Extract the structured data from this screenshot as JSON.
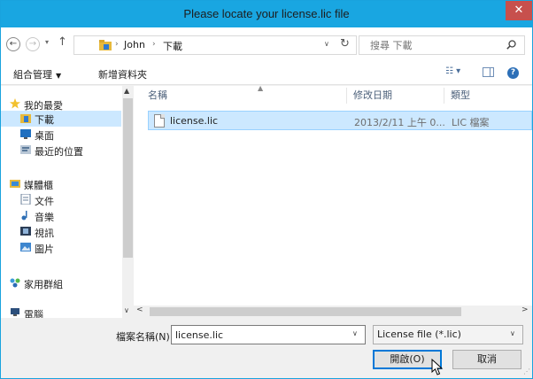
{
  "window": {
    "title": "Please locate your license.lic file",
    "close_glyph": "✕"
  },
  "address": {
    "back_glyph": "←",
    "forward_glyph": "→",
    "recent_glyph": "▾",
    "up_glyph": "↑",
    "crumbs": [
      "John",
      "下載"
    ],
    "crumb_sep": "›",
    "dropdown_glyph": "∨",
    "refresh_glyph": "↻"
  },
  "search": {
    "placeholder": "搜尋 下載"
  },
  "toolbar": {
    "organize_label": "組合管理",
    "organize_arrow": "▼",
    "new_folder_label": "新增資料夾",
    "view_glyph": "☷ ▾",
    "help_glyph": "?"
  },
  "nav": {
    "items": [
      {
        "label": "我的最愛",
        "icon": "star-icon"
      },
      {
        "label": "下載",
        "icon": "downloads-folder-icon"
      },
      {
        "label": "桌面",
        "icon": "desktop-icon"
      },
      {
        "label": "最近的位置",
        "icon": "recent-places-icon"
      },
      {
        "label": "媒體櫃",
        "icon": "libraries-icon"
      },
      {
        "label": "文件",
        "icon": "documents-icon"
      },
      {
        "label": "音樂",
        "icon": "music-icon"
      },
      {
        "label": "視訊",
        "icon": "videos-icon"
      },
      {
        "label": "圖片",
        "icon": "pictures-icon"
      },
      {
        "label": "家用群組",
        "icon": "homegroup-icon"
      },
      {
        "label": "電腦",
        "icon": "computer-icon"
      }
    ],
    "scroll_up": "▲",
    "scroll_down": "∨"
  },
  "files": {
    "columns": {
      "name": "名稱",
      "date": "修改日期",
      "type": "類型"
    },
    "sort_glyph": "▲",
    "rows": [
      {
        "name": "license.lic",
        "date": "2013/2/11 上午 0...",
        "type": "LIC 檔案"
      }
    ],
    "hscroll_left": "<",
    "hscroll_right": ">"
  },
  "bottom": {
    "filename_label": "檔案名稱(N):",
    "filename_value": "license.lic",
    "filetype_value": "License file (*.lic)",
    "dropdown_glyph": "∨",
    "open_label": "開啟(O)",
    "cancel_label": "取消"
  },
  "colors": {
    "titlebar": "#19a6e1",
    "close": "#c7504d",
    "selection": "#cce8ff",
    "accent": "#0078d7"
  }
}
